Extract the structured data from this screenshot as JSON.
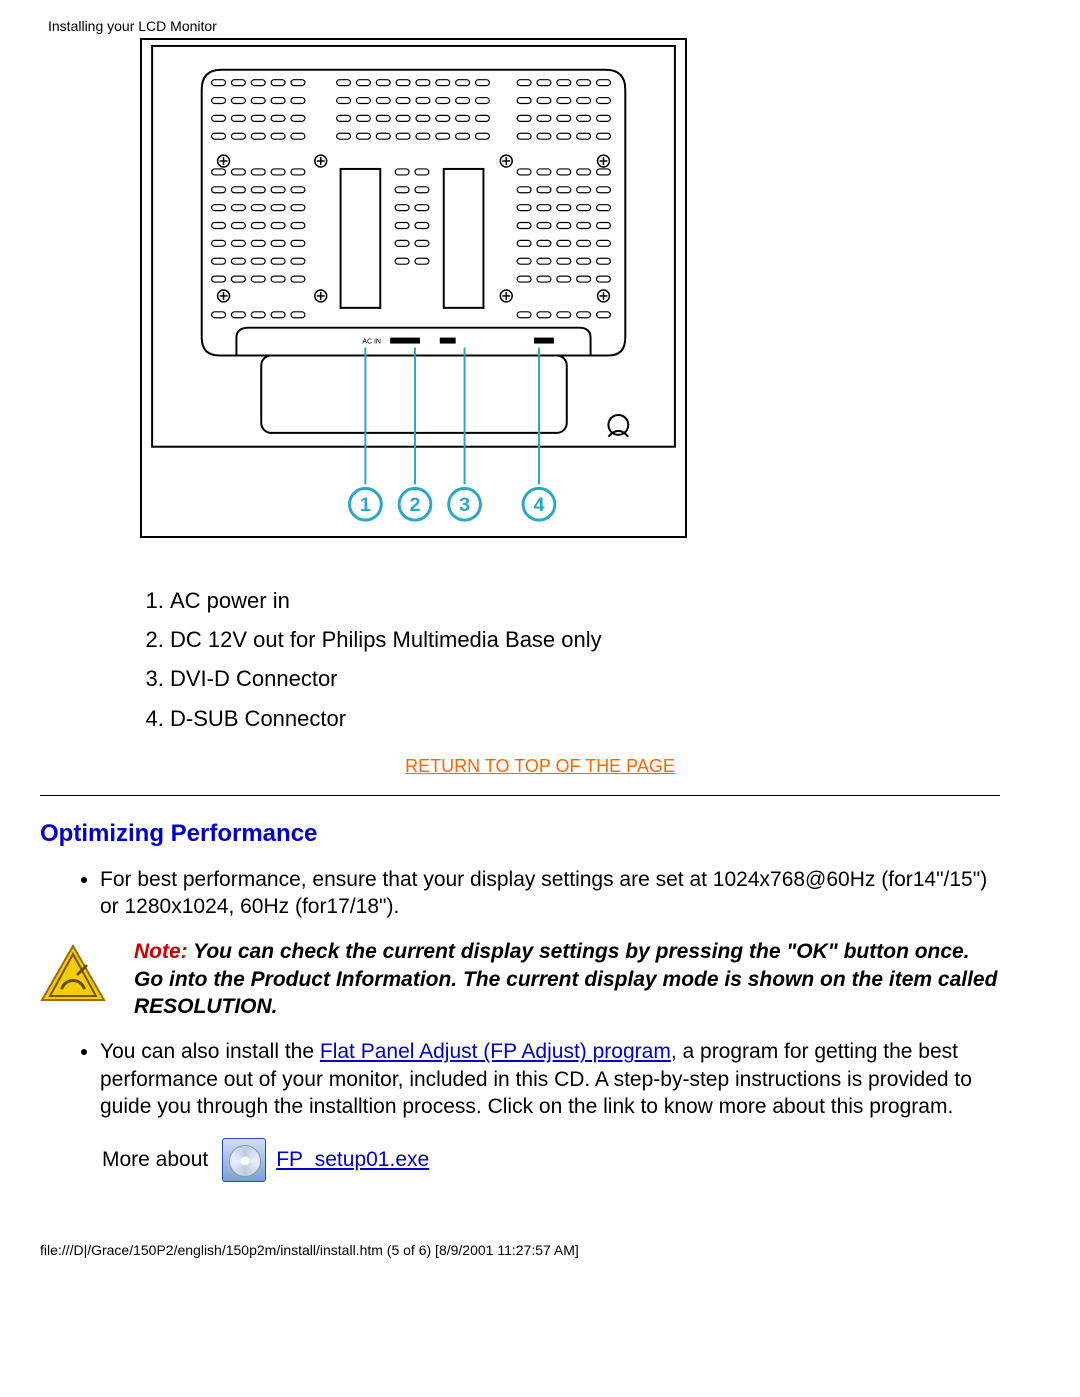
{
  "header": {
    "title": "Installing your LCD Monitor"
  },
  "legend": {
    "items": [
      "AC power in",
      "DC 12V out for Philips Multimedia Base only",
      "DVI-D Connector",
      "D-SUB Connector"
    ]
  },
  "returnLink": "RETURN TO TOP OF THE PAGE",
  "section": {
    "heading": "Optimizing Performance"
  },
  "bullets": {
    "b1": "For best performance, ensure that your display settings are set at 1024x768@60Hz (for14\"/15\") or 1280x1024, 60Hz (for17/18\").",
    "b2_pre": "You can also install the ",
    "b2_link": "Flat Panel Adjust (FP Adjust) program",
    "b2_post": ", a program for getting the best performance out of your monitor, included in this CD. A step-by-step instructions is provided to guide you through the installtion process. Click on the link to know more about this program."
  },
  "note": {
    "label": "Note:",
    "text": " You can check the current display settings by pressing the \"OK\" button once. Go into the Product Information. The current display mode is shown on the item called RESOLUTION."
  },
  "more": {
    "label": "More about",
    "linkText": "FP_setup01.exe"
  },
  "footer": {
    "path": "file:///D|/Grace/150P2/english/150p2m/install/install.htm (5 of 6) [8/9/2001 11:27:57 AM]"
  }
}
